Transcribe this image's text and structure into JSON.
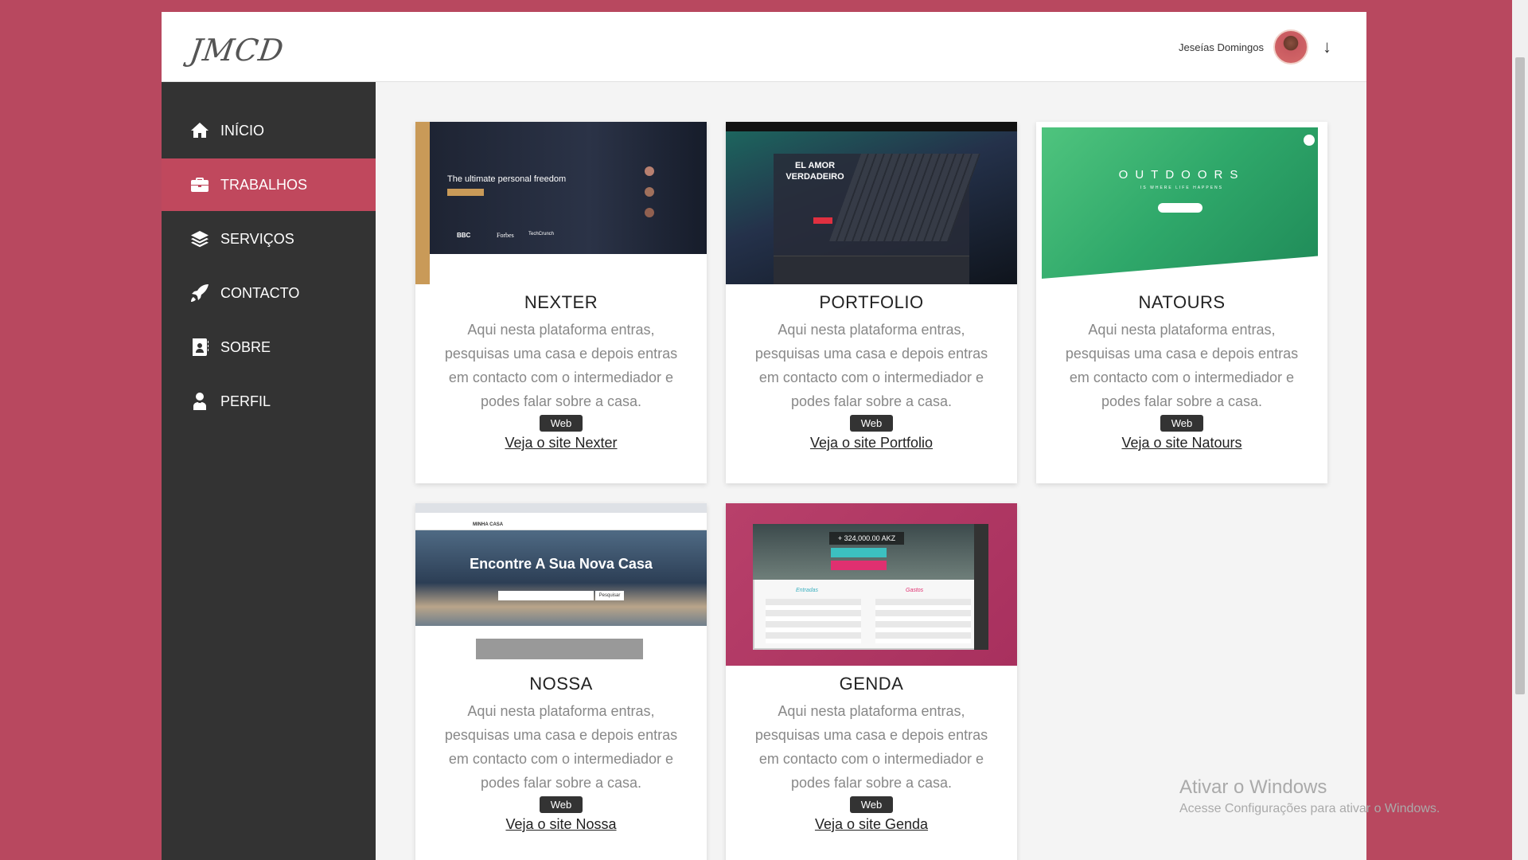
{
  "header": {
    "logo": "JMCD",
    "user_name": "Jeseías Domingos",
    "arrow": "↓"
  },
  "sidebar": {
    "items": [
      {
        "label": "INÍCIO",
        "icon": "home-icon",
        "active": false
      },
      {
        "label": "TRABALHOS",
        "icon": "briefcase-icon",
        "active": true
      },
      {
        "label": "SERVIÇOS",
        "icon": "layers-icon",
        "active": false
      },
      {
        "label": "CONTACTO",
        "icon": "rocket-icon",
        "active": false
      },
      {
        "label": "SOBRE",
        "icon": "contact-book-icon",
        "active": false
      },
      {
        "label": "PERFIL",
        "icon": "user-tie-icon",
        "active": false
      }
    ]
  },
  "cards": [
    {
      "title": "NEXTER",
      "description": "Aqui nesta plataforma entras, pesquisas uma casa e depois entras em contacto com o intermediador e podes falar sobre a casa.",
      "tag": "Web",
      "link": "Veja o site Nexter",
      "thumb_text": "The ultimate personal freedom",
      "thumb_brands": [
        "BBC",
        "Forbes",
        "TechCrunch"
      ]
    },
    {
      "title": "PORTFOLIO",
      "description": "Aqui nesta plataforma entras, pesquisas uma casa e depois entras em contacto com o intermediador e podes falar sobre a casa.",
      "tag": "Web",
      "link": "Veja o site Portfolio",
      "thumb_text": "EL AMOR VERDADEIRO"
    },
    {
      "title": "NATOURS",
      "description": "Aqui nesta plataforma entras, pesquisas uma casa e depois entras em contacto com o intermediador e podes falar sobre a casa.",
      "tag": "Web",
      "link": "Veja o site Natours",
      "thumb_text": "OUTDOORS",
      "thumb_subtext": "IS WHERE LIFE HAPPENS"
    },
    {
      "title": "NOSSA",
      "description": "Aqui nesta plataforma entras, pesquisas uma casa e depois entras em contacto com o intermediador e podes falar sobre a casa.",
      "tag": "Web",
      "link": "Veja o site Nossa",
      "thumb_text": "Encontre A Sua Nova Casa",
      "thumb_brand": "MINHA CASA",
      "thumb_button": "Pesquisar"
    },
    {
      "title": "GENDA",
      "description": "Aqui nesta plataforma entras, pesquisas uma casa e depois entras em contacto com o intermediador e podes falar sobre a casa.",
      "tag": "Web",
      "link": "Veja o site Genda",
      "thumb_value": "+ 324,000.00 AKZ",
      "thumb_cols": [
        "Entradas",
        "Gastos"
      ]
    }
  ],
  "windows_watermark": {
    "line1": "Ativar o Windows",
    "line2": "Acesse Configurações para ativar o Windows."
  }
}
